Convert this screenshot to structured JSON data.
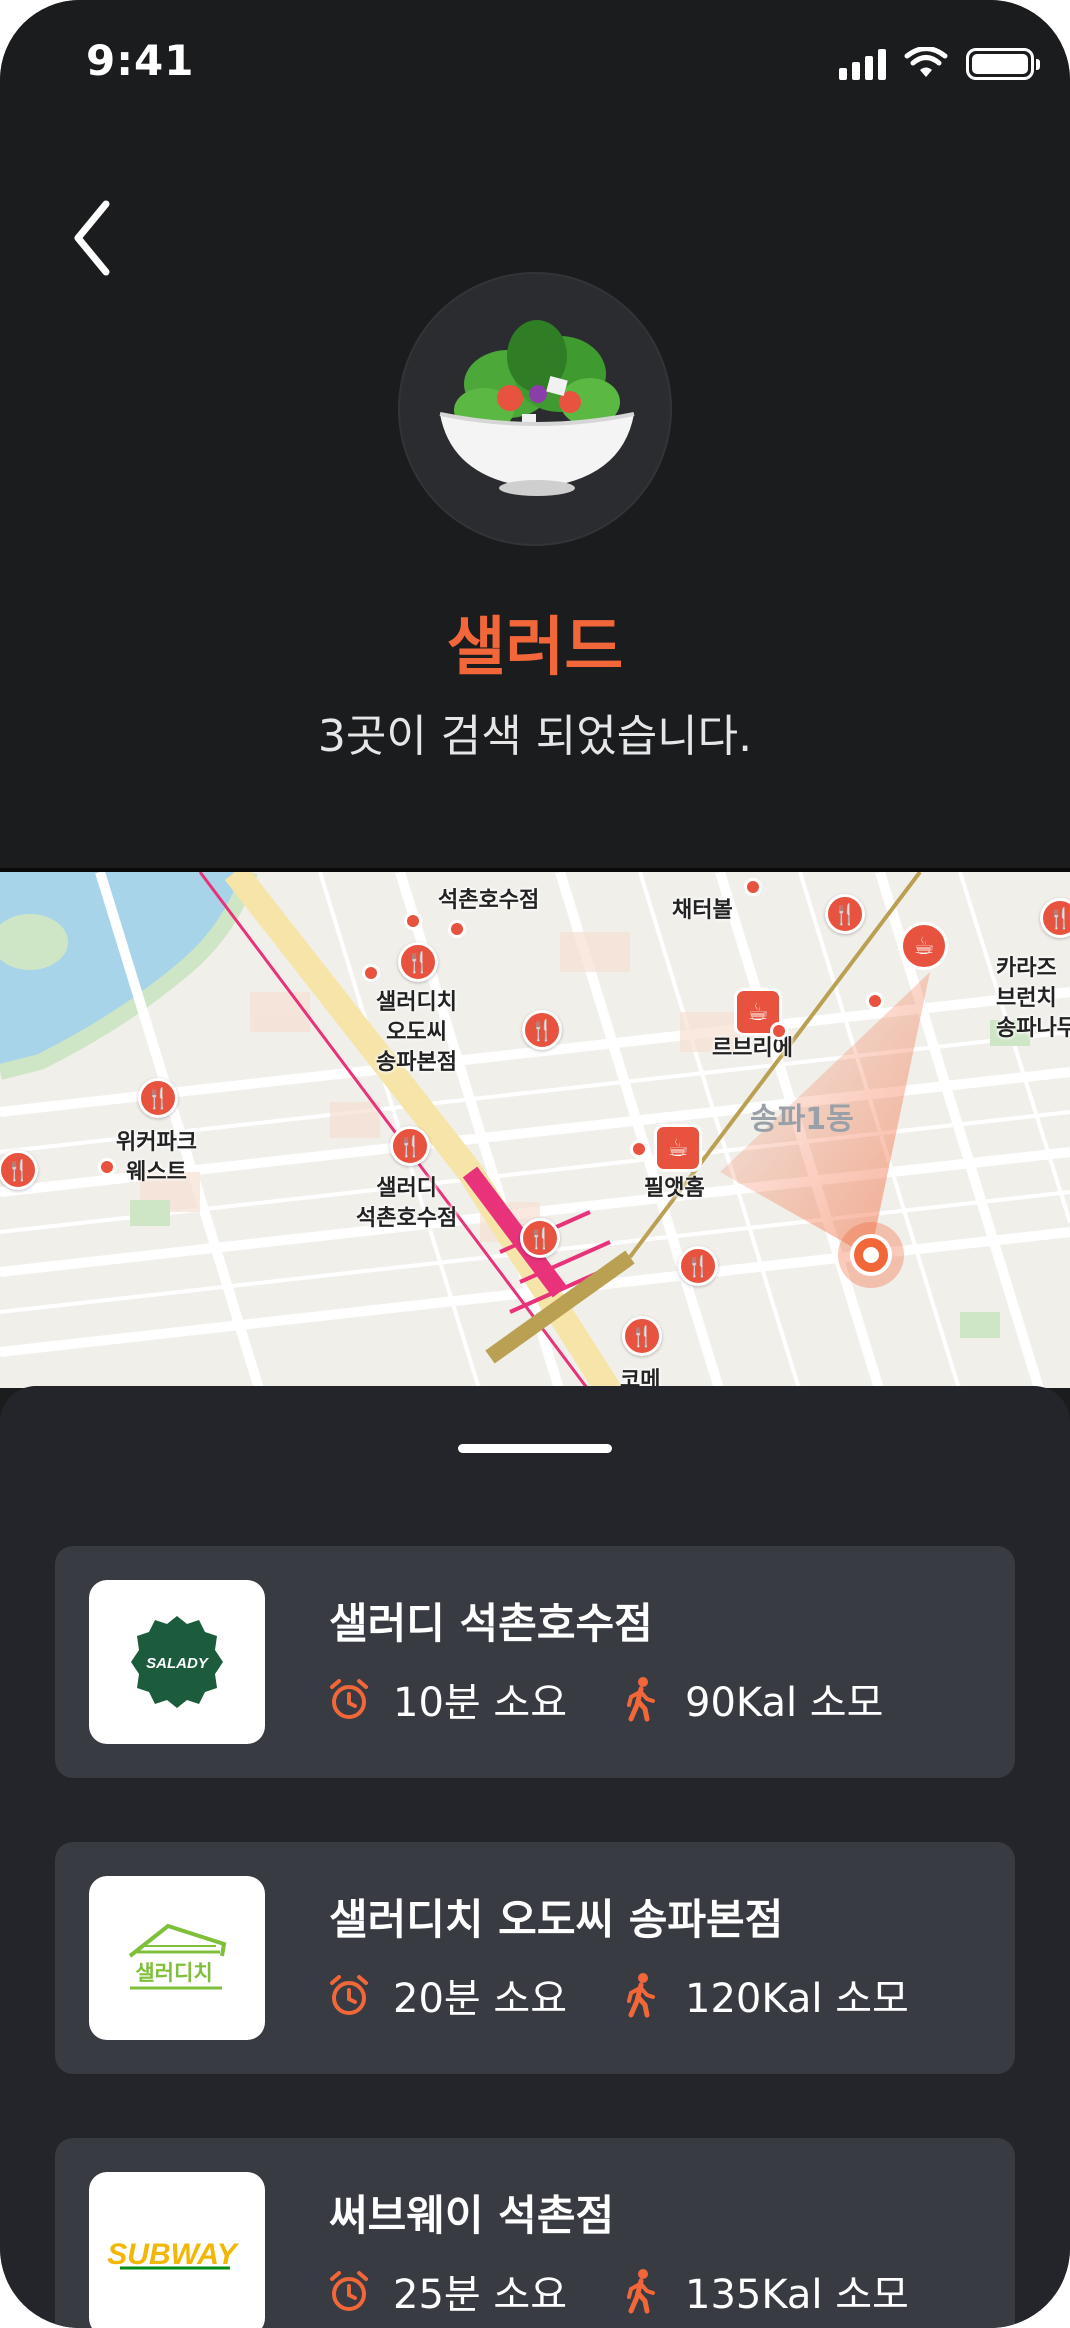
{
  "status_bar": {
    "time": "9:41"
  },
  "header": {
    "category": "샐러드",
    "result_text": "3곳이 검색 되었습니다."
  },
  "map": {
    "labels": {
      "seokchon_top": "석촌호수점",
      "chaeteobol": "채터볼",
      "karazu": "카라즈\n브런치\n송파나무",
      "saladichi": "샐러디치\n오도씨\n송파본점",
      "lebrie": "르브리에",
      "district": "송파1동",
      "wicker": "위커파크\n웨스트",
      "saladi_seokchon": "샐러디\n석촌호수점",
      "pilaenhom": "필앳홈",
      "kome": "코메"
    }
  },
  "stores": [
    {
      "name": "샐러디 석촌호수점",
      "time": "10분 소요",
      "kcal": "90Kal 소모",
      "logo": "SALADY"
    },
    {
      "name": "샐러디치 오도씨 송파본점",
      "time": "20분 소요",
      "kcal": "120Kal 소모",
      "logo": "샐러디치"
    },
    {
      "name": "써브웨이 석촌점",
      "time": "25분 소요",
      "kcal": "135Kal 소모",
      "logo": "SUBWAY"
    }
  ],
  "colors": {
    "accent": "#f2673a",
    "background": "#1b1c1e",
    "sheet": "#24252a",
    "card": "#383b42"
  },
  "icons": {
    "back": "chevron-left-icon",
    "time": "alarm-clock-icon",
    "walk": "walking-person-icon",
    "food": "salad-icon"
  }
}
